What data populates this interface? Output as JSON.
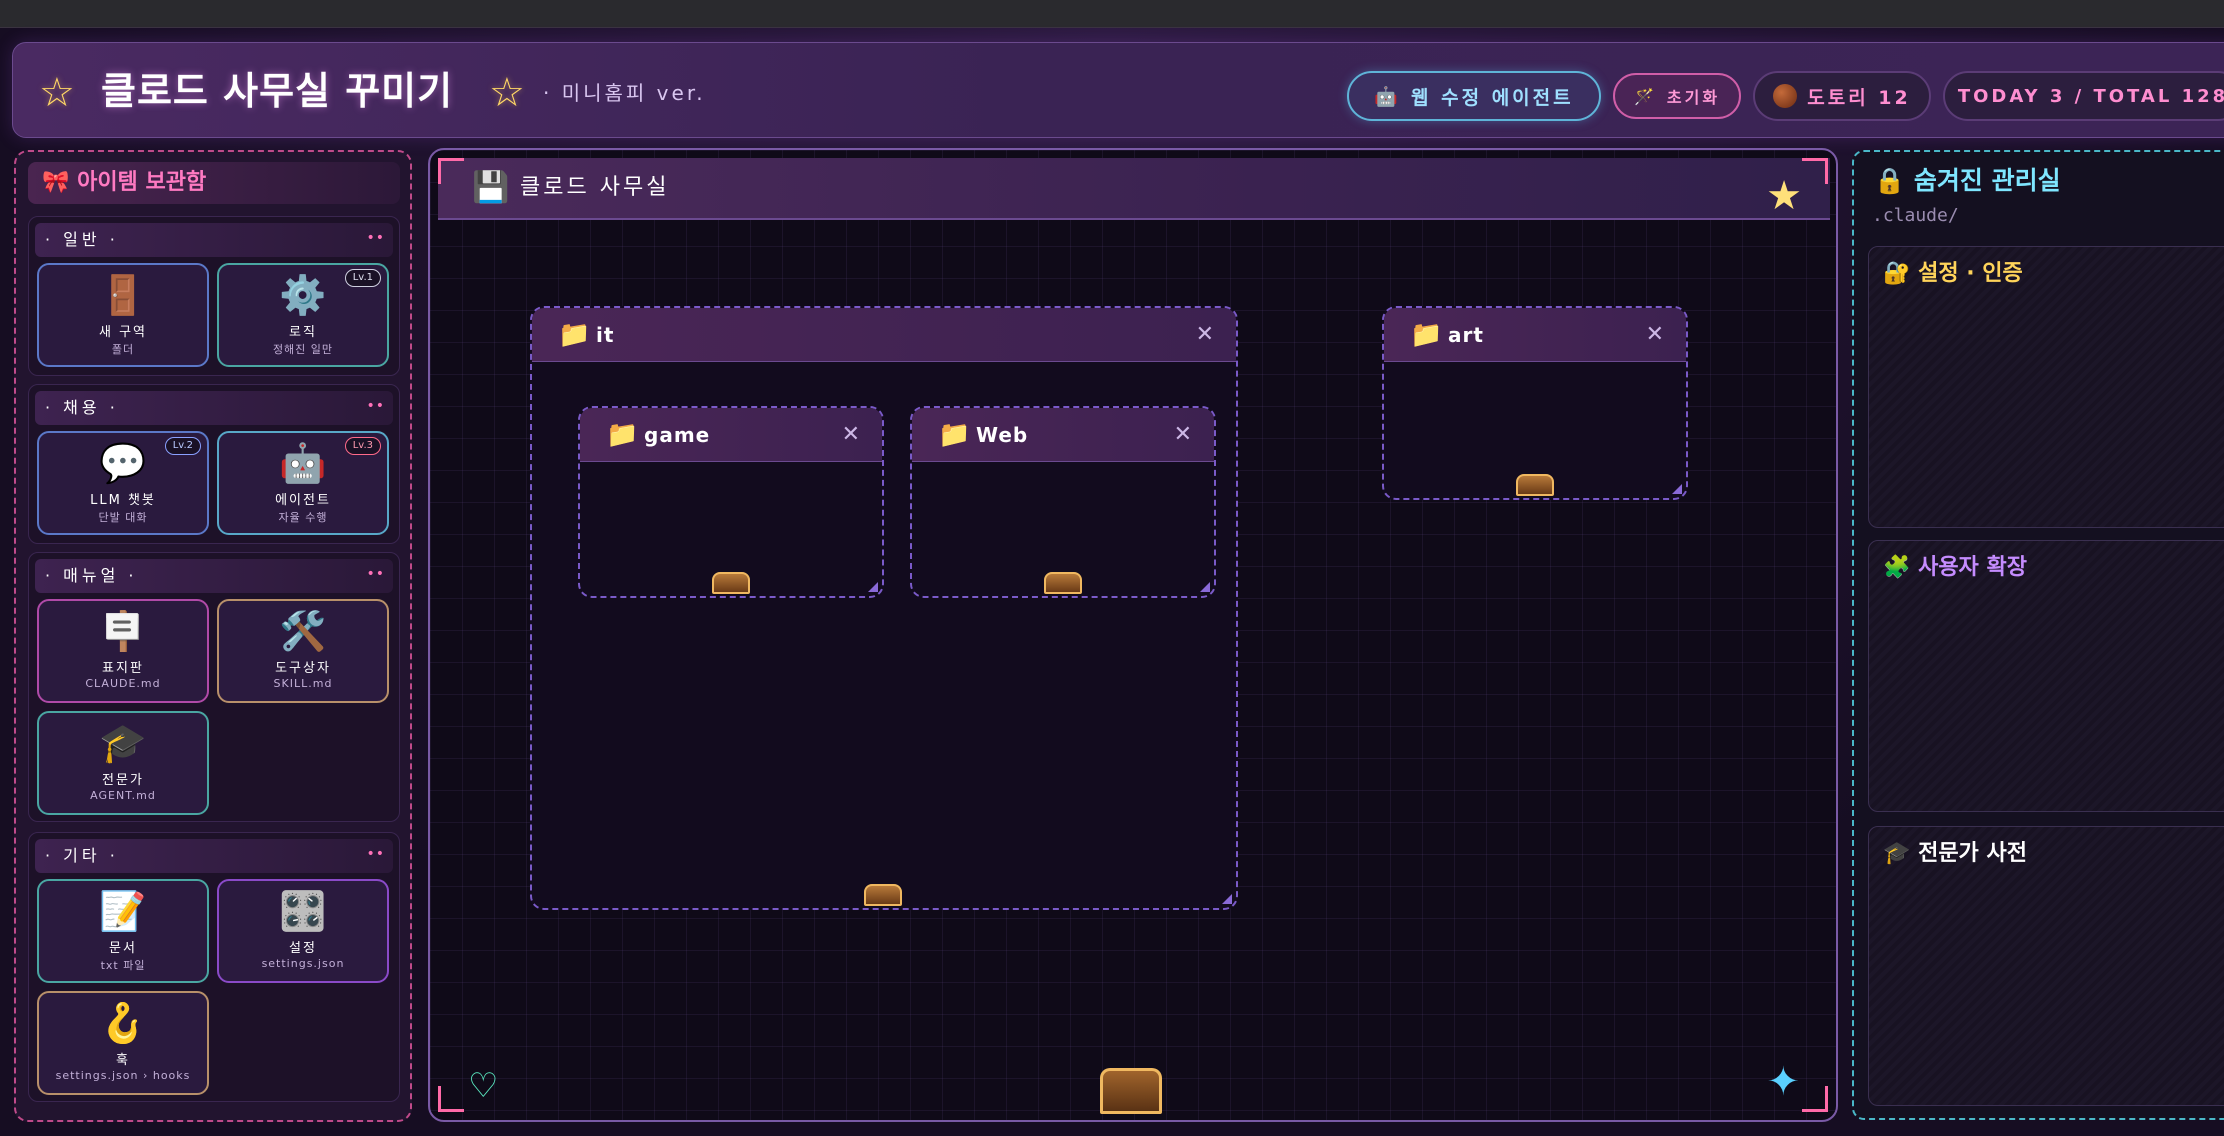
{
  "header": {
    "title": "클로드 사무실 꾸미기",
    "subtitle": "· 미니홈피 ver.",
    "agent_button": "웹 수정 에이전트",
    "reset_button": "초기화",
    "acorn_label": "도토리 12",
    "visits": "TODAY 3 / TOTAL 128"
  },
  "inventory": {
    "title": "아이템 보관함",
    "groups": [
      {
        "label": "· 일반 ·",
        "items": [
          {
            "name": "새 구역",
            "sub": "폴더",
            "icon": "door-icon",
            "lv": ""
          },
          {
            "name": "로직",
            "sub": "정해진 일만",
            "icon": "gear-icon",
            "lv": "Lv.1"
          }
        ]
      },
      {
        "label": "· 채용 ·",
        "items": [
          {
            "name": "LLM 챗봇",
            "sub": "단발 대화",
            "icon": "speech-bubble-icon",
            "lv": "Lv.2"
          },
          {
            "name": "에이전트",
            "sub": "자율 수행",
            "icon": "robot-icon",
            "lv": "Lv.3"
          }
        ]
      },
      {
        "label": "· 매뉴얼 ·",
        "items": [
          {
            "name": "표지판",
            "sub": "CLAUDE.md",
            "icon": "signpost-icon",
            "lv": ""
          },
          {
            "name": "도구상자",
            "sub": "SKILL.md",
            "icon": "tools-icon",
            "lv": ""
          },
          {
            "name": "전문가",
            "sub": "AGENT.md",
            "icon": "graduation-cap-icon",
            "lv": ""
          }
        ]
      },
      {
        "label": "· 기타 ·",
        "items": [
          {
            "name": "문서",
            "sub": "txt 파일",
            "icon": "memo-icon",
            "lv": ""
          },
          {
            "name": "설정",
            "sub": "settings.json",
            "icon": "control-knobs-icon",
            "lv": ""
          },
          {
            "name": "훅",
            "sub": "settings.json › hooks",
            "icon": "hook-icon",
            "lv": ""
          }
        ]
      }
    ]
  },
  "office": {
    "title": "클로드 사무실",
    "folders": [
      {
        "name": "it"
      },
      {
        "name": "game"
      },
      {
        "name": "Web"
      },
      {
        "name": "art"
      }
    ]
  },
  "hidden_room": {
    "title": "숨겨진 관리실",
    "path": ".claude/",
    "sections": [
      {
        "title": "설정 · 인증",
        "color": "#ffd45a"
      },
      {
        "title": "사용자 확장",
        "color": "#c58cff"
      },
      {
        "title": "전문가 사전",
        "color": "#ffffff"
      }
    ]
  },
  "colors": {
    "accent_pink": "#ff7ac2",
    "accent_cyan": "#7fe6ff",
    "gold": "#ffd766"
  }
}
